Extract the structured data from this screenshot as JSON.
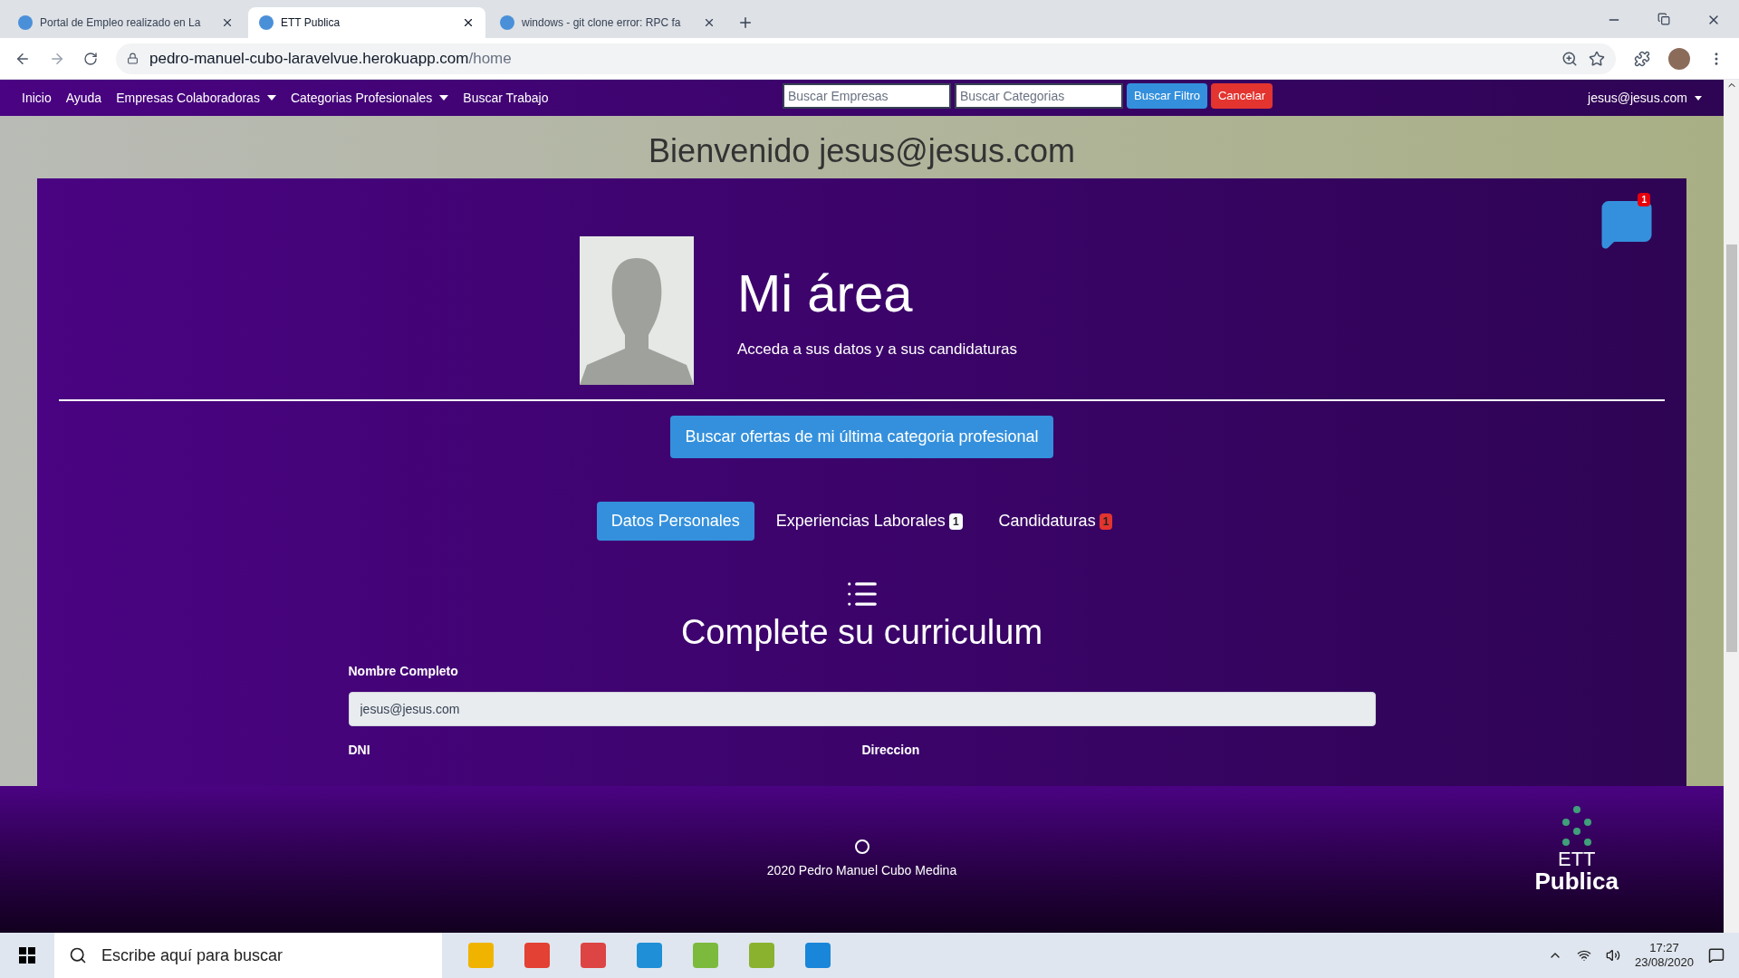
{
  "browser": {
    "tabs": [
      {
        "title": "Portal de Empleo realizado en La",
        "selected": false
      },
      {
        "title": "ETT Publica",
        "selected": true
      },
      {
        "title": "windows - git clone error: RPC fa",
        "selected": false
      }
    ],
    "url_host": "pedro-manuel-cubo-laravelvue.herokuapp.com",
    "url_path": "/home"
  },
  "navbar": {
    "links": [
      {
        "label": "Inicio",
        "dropdown": false
      },
      {
        "label": "Ayuda",
        "dropdown": false
      },
      {
        "label": "Empresas Colaboradoras",
        "dropdown": true
      },
      {
        "label": "Categorias Profesionales",
        "dropdown": true
      },
      {
        "label": "Buscar Trabajo",
        "dropdown": false
      }
    ],
    "search_companies": {
      "placeholder": "Buscar Empresas"
    },
    "search_categories": {
      "placeholder": "Buscar Categorias"
    },
    "filter_button": "Buscar Filtro",
    "cancel_button": "Cancelar",
    "user_menu": "jesus@jesus.com"
  },
  "welcome": "Bienvenido jesus@jesus.com",
  "area": {
    "title": "Mi área",
    "subtitle": "Acceda a sus datos y a sus candidaturas",
    "messages_badge": "1",
    "search_offers_button": "Buscar ofertas de mi última categoria profesional",
    "tabs": [
      {
        "label": "Datos Personales",
        "selected": true
      },
      {
        "label": "Experiencias Laborales",
        "selected": false,
        "badge": {
          "text": "1",
          "color": "#f8f9fa"
        }
      },
      {
        "label": "Candidaturas",
        "selected": false,
        "badge": {
          "text": "1",
          "color": "#e3342f"
        }
      }
    ]
  },
  "form": {
    "heading": "Complete su curriculum",
    "fields": [
      {
        "label": "Nombre Completo",
        "value": "jesus@jesus.com"
      }
    ],
    "next_labels": [
      "DNI",
      "Direccion"
    ]
  },
  "footer": {
    "copyright": "2020 Pedro Manuel Cubo Medina",
    "logo_top": "ETT",
    "logo_bottom": "Publica"
  },
  "taskbar": {
    "search_placeholder": "Escribe aquí para buscar",
    "time": "17:27",
    "date": "23/08/2020"
  }
}
